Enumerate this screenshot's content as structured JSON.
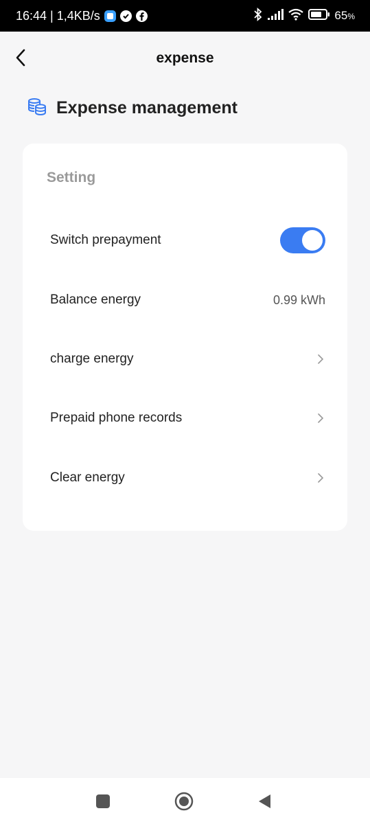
{
  "status_bar": {
    "time_speed": "16:44 | 1,4KB/s",
    "battery_percent": "65"
  },
  "header": {
    "title": "expense"
  },
  "section": {
    "title": "Expense management",
    "icon": "coins-icon"
  },
  "card": {
    "title": "Setting",
    "rows": [
      {
        "label": "Switch prepayment",
        "type": "toggle",
        "enabled": true
      },
      {
        "label": "Balance energy",
        "type": "value",
        "value": "0.99 kWh"
      },
      {
        "label": "charge energy",
        "type": "link"
      },
      {
        "label": "Prepaid phone records",
        "type": "link"
      },
      {
        "label": "Clear energy",
        "type": "link"
      }
    ]
  },
  "colors": {
    "accent": "#3a7cf2",
    "background": "#f6f6f7",
    "card": "#ffffff"
  }
}
